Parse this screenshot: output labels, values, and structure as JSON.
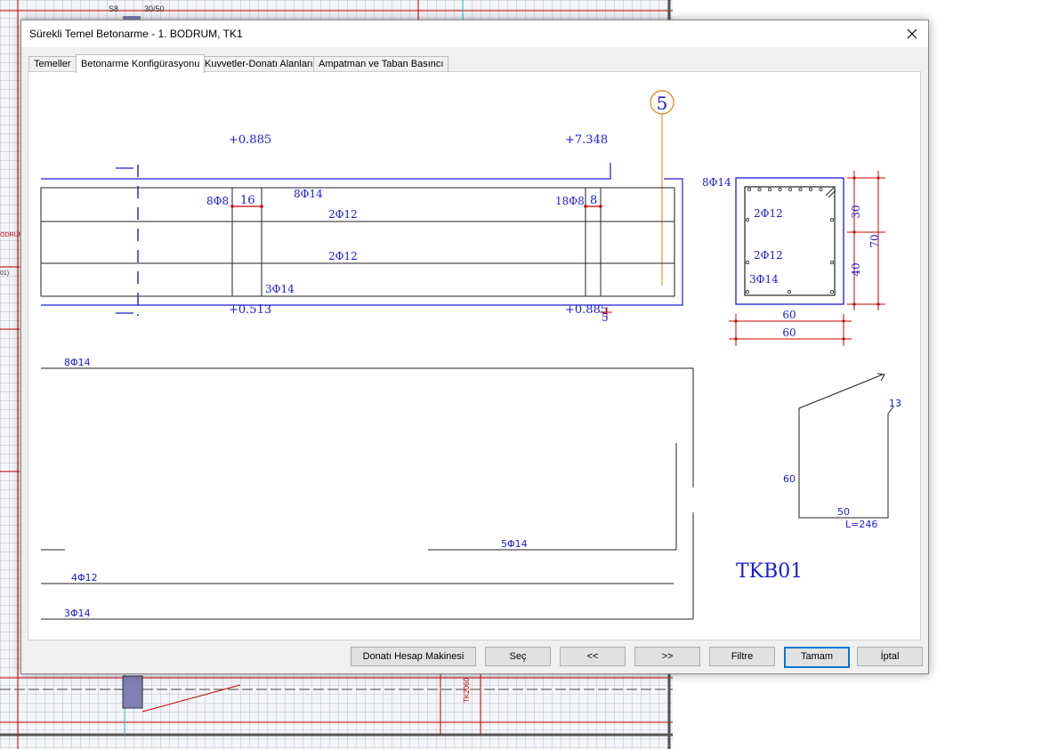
{
  "background": {
    "labels": [
      "S8",
      "30/50",
      "ODRUM",
      "01)",
      "TK2060"
    ]
  },
  "dialog": {
    "title": "Sürekli Temel Betonarme - 1. BODRUM, TK1",
    "close_icon": "close-icon"
  },
  "tabs": [
    {
      "label": "Temeller",
      "active": false
    },
    {
      "label": "Betonarme Konfigürasyonu",
      "active": true
    },
    {
      "label": "Kuvvetler-Donatı Alanları",
      "active": false
    },
    {
      "label": "Ampatman ve Taban Basıncı",
      "active": false
    }
  ],
  "drawing": {
    "axis_label": "5",
    "elevations": {
      "top_left": "+0.885",
      "top_right": "+7.348",
      "bottom_left": "+0.513",
      "bottom_right": "+0.885"
    },
    "stirrups_left": "8Φ8",
    "stirrup_spacing_left": "16",
    "stirrups_right": "18Φ8",
    "stirrup_spacing_right": "8",
    "top_bars": "8Φ14",
    "web_bars_1": "2Φ12",
    "web_bars_2": "2Φ12",
    "bottom_bars": "3Φ14",
    "end_dim": "5",
    "section": {
      "top_bars": "8Φ14",
      "web_bars_1": "2Φ12",
      "web_bars_2": "2Φ12",
      "bottom_bars": "3Φ14",
      "dim_upper": "30",
      "dim_lower": "40",
      "dim_total": "70",
      "width_1": "60",
      "width_2": "60"
    },
    "schedule": {
      "bar_top": "8Φ14",
      "bar_mid": "5Φ14",
      "bar_4": "4Φ12",
      "bar_5": "3Φ14"
    },
    "stirrup_shape": {
      "hook": "13",
      "height": "60",
      "width": "50",
      "length": "L=246"
    },
    "label": "TKB01"
  },
  "buttons": {
    "calculator": "Donatı Hesap Makinesi",
    "select": "Seç",
    "prev": "<<",
    "next": ">>",
    "filter": "Filtre",
    "ok": "Tamam",
    "cancel": "İptal"
  }
}
